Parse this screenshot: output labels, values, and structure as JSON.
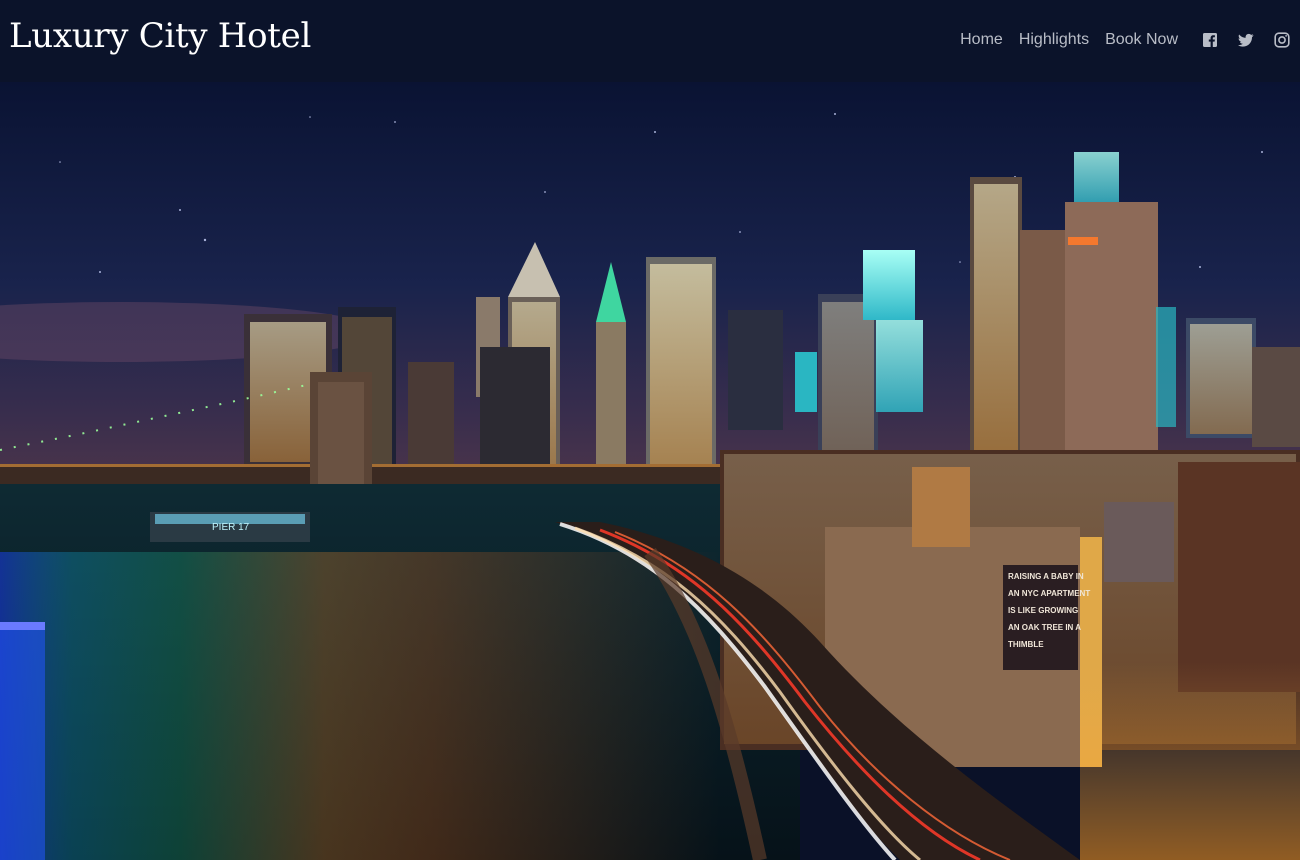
{
  "header": {
    "brand": "Luxury City Hotel"
  },
  "nav": {
    "items": [
      {
        "label": "Home"
      },
      {
        "label": "Highlights"
      },
      {
        "label": "Book Now"
      }
    ],
    "social": [
      {
        "icon": "facebook-icon"
      },
      {
        "icon": "twitter-icon"
      },
      {
        "icon": "instagram-icon"
      }
    ]
  },
  "hero": {
    "image": "night-city-skyline-with-bridge-and-river",
    "billboard_lines": [
      "RAISING A BABY IN",
      "AN NYC APARTMENT",
      "IS LIKE GROWING",
      "AN OAK TREE IN A",
      "THIMBLE"
    ],
    "pier_sign": "PIER 17"
  },
  "colors": {
    "navbar": "#0b132a",
    "nav_text": "#b9bdc7",
    "brand_text": "#ffffff"
  }
}
